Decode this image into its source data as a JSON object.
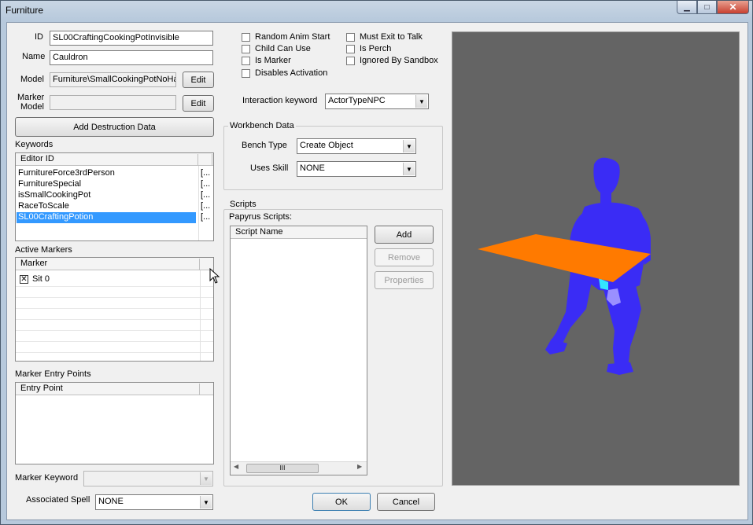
{
  "window": {
    "title": "Furniture",
    "close_glyph": "✕",
    "min_glyph": "▁",
    "max_glyph": "□"
  },
  "form": {
    "id_label": "ID",
    "id_value": "SL00CraftingCookingPotInvisible",
    "name_label": "Name",
    "name_value": "Cauldron",
    "model_label": "Model",
    "model_value": "Furniture\\SmallCookingPotNoHa",
    "model_edit": "Edit",
    "marker_model_label_1": "Marker",
    "marker_model_label_2": "Model",
    "marker_model_value": "",
    "marker_edit": "Edit",
    "add_destruction": "Add Destruction Data"
  },
  "keywords": {
    "label": "Keywords",
    "header_editor_id": "Editor ID",
    "header_col2": "",
    "rows": [
      {
        "name": "FurnitureForce3rdPerson",
        "extra": "[..."
      },
      {
        "name": "FurnitureSpecial",
        "extra": "[..."
      },
      {
        "name": "isSmallCookingPot",
        "extra": "[..."
      },
      {
        "name": "RaceToScale",
        "extra": "[..."
      },
      {
        "name": "SL00CraftingPotion",
        "extra": "[..."
      }
    ],
    "selected_index": 4
  },
  "active_markers": {
    "label": "Active Markers",
    "header": "Marker",
    "rows": [
      {
        "name": "Sit 0",
        "checked": true
      }
    ]
  },
  "marker_entry": {
    "label": "Marker Entry Points",
    "header": "Entry Point"
  },
  "marker_keyword": {
    "label": "Marker Keyword",
    "value": ""
  },
  "associated_spell": {
    "label": "Associated Spell",
    "value": "NONE"
  },
  "flags": [
    {
      "label": "Random Anim Start",
      "checked": false
    },
    {
      "label": "Child Can Use",
      "checked": false
    },
    {
      "label": "Is Marker",
      "checked": false
    },
    {
      "label": "Disables Activation",
      "checked": false
    },
    {
      "label": "Must Exit to Talk",
      "checked": false
    },
    {
      "label": "Is Perch",
      "checked": false
    },
    {
      "label": "Ignored By Sandbox",
      "checked": false
    }
  ],
  "interaction": {
    "label": "Interaction keyword",
    "value": "ActorTypeNPC"
  },
  "workbench": {
    "title": "Workbench Data",
    "bench_type_label": "Bench Type",
    "bench_type_value": "Create Object",
    "uses_skill_label": "Uses Skill",
    "uses_skill_value": "NONE"
  },
  "scripts": {
    "title": "Scripts",
    "papyrus_label": "Papyrus Scripts:",
    "header": "Script Name",
    "add": "Add",
    "remove": "Remove",
    "properties": "Properties",
    "scroll_grip": "III"
  },
  "dialog": {
    "ok": "OK",
    "cancel": "Cancel"
  },
  "colors": {
    "selection": "#3399ff",
    "preview_bg": "#646464",
    "figure": "#3a2cf5",
    "plane": "#ff7a00",
    "highlight": "#33e5ff"
  },
  "icons": {
    "dropdown": "chevron-down-icon",
    "cursor": "mouse-pointer-icon"
  }
}
